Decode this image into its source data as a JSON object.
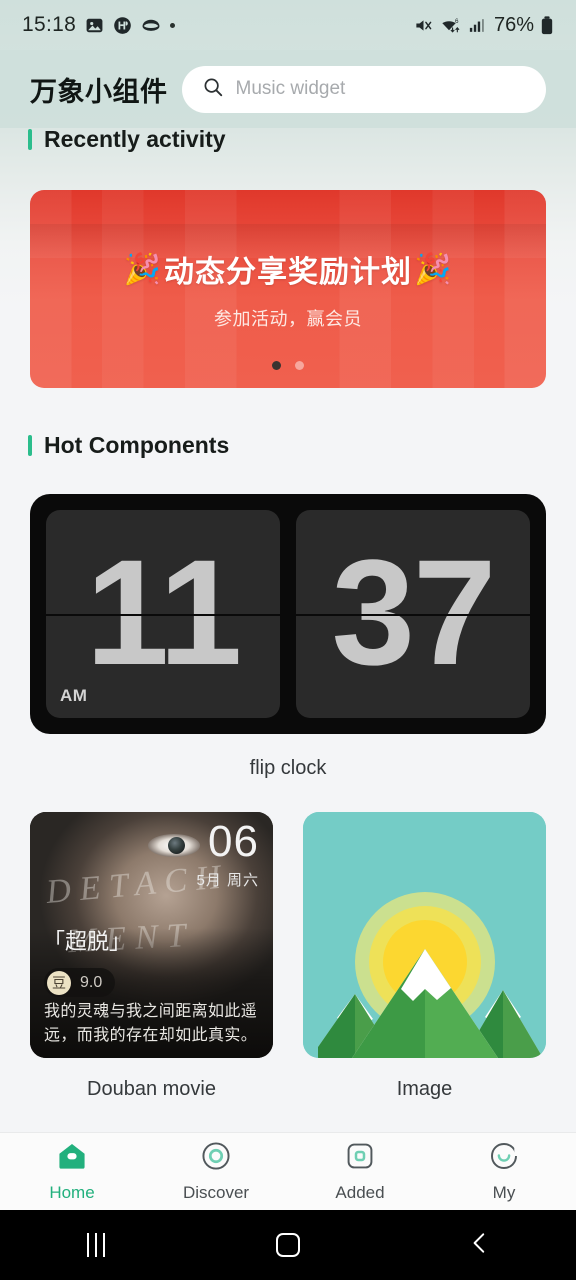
{
  "status_bar": {
    "time": "15:18",
    "left_icons": [
      "photo-icon",
      "music-badge-icon",
      "shell-icon",
      "dot-icon"
    ],
    "right_icons": [
      "mute-icon",
      "wifi-6-icon",
      "signal-icon",
      "battery-icon"
    ],
    "battery_percent": "76%"
  },
  "header": {
    "app_title": "万象小组件",
    "search_placeholder": "Music widget",
    "search_value": ""
  },
  "sections": {
    "recent": {
      "title": "Recently activity"
    },
    "hot": {
      "title": "Hot Components"
    }
  },
  "banner": {
    "title_text": "动态分享奖励计划",
    "emoji_left": "🎉",
    "emoji_right": "🎉",
    "subtitle": "参加活动，赢会员",
    "dots": [
      {
        "active": true
      },
      {
        "active": false
      }
    ]
  },
  "widgets": [
    {
      "id": "flip-clock",
      "label": "flip clock",
      "hours": "11",
      "minutes": "37",
      "meridiem": "AM"
    },
    {
      "id": "douban-movie",
      "label": "Douban movie",
      "day_number": "06",
      "date_text": "5月 周六",
      "movie_title": "「超脱」",
      "bean_glyph": "豆",
      "score": "9.0",
      "quote": "我的灵魂与我之间距离如此遥远，而我的存在却如此真实。",
      "poster_text_line1": "DETACH",
      "poster_text_line2": "MENT"
    },
    {
      "id": "image",
      "label": "Image",
      "illustration": "mountain-sunrise"
    }
  ],
  "bottom_nav": [
    {
      "id": "home",
      "label": "Home",
      "icon": "home-icon",
      "active": true
    },
    {
      "id": "discover",
      "label": "Discover",
      "icon": "compass-circle-icon",
      "active": false
    },
    {
      "id": "added",
      "label": "Added",
      "icon": "square-added-icon",
      "active": false
    },
    {
      "id": "my",
      "label": "My",
      "icon": "profile-icon",
      "active": false
    }
  ],
  "android_nav": {
    "recents": "recents-icon",
    "home": "home-square-icon",
    "back": "back-chevron-icon"
  },
  "colors": {
    "accent_green": "#2bbd8c",
    "banner_red": "#ea4a38",
    "header_bg": "#cfe0dc",
    "page_bg": "#f4f5f7"
  }
}
